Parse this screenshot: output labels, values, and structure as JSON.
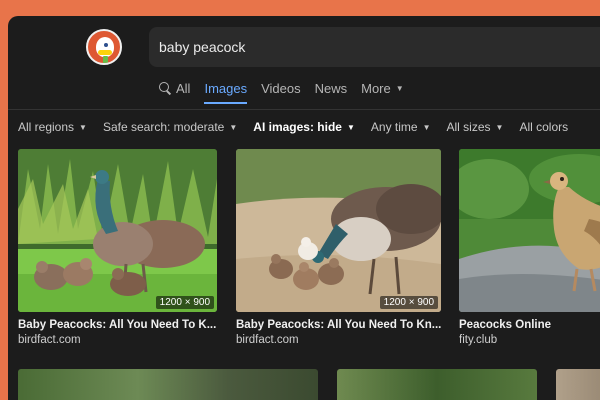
{
  "search": {
    "query": "baby peacock"
  },
  "tabs": [
    {
      "label": "All",
      "icon": "search-icon"
    },
    {
      "label": "Images"
    },
    {
      "label": "Videos"
    },
    {
      "label": "News"
    },
    {
      "label": "More"
    }
  ],
  "filters": [
    {
      "label": "All regions"
    },
    {
      "label": "Safe search: moderate"
    },
    {
      "label": "AI images: hide"
    },
    {
      "label": "Any time"
    },
    {
      "label": "All sizes"
    },
    {
      "label": "All colors"
    }
  ],
  "results": [
    {
      "title": "Baby Peacocks: All You Need To K...",
      "domain": "birdfact.com",
      "size": "1200 × 900"
    },
    {
      "title": "Baby Peacocks: All You Need To Kn...",
      "domain": "birdfact.com",
      "size": "1200 × 900"
    },
    {
      "title": "Peacocks Online",
      "domain": "fity.club",
      "size": ""
    }
  ],
  "colors": {
    "accent": "#6aaaff",
    "background": "#1c1c1c",
    "brand": "#de5833"
  }
}
